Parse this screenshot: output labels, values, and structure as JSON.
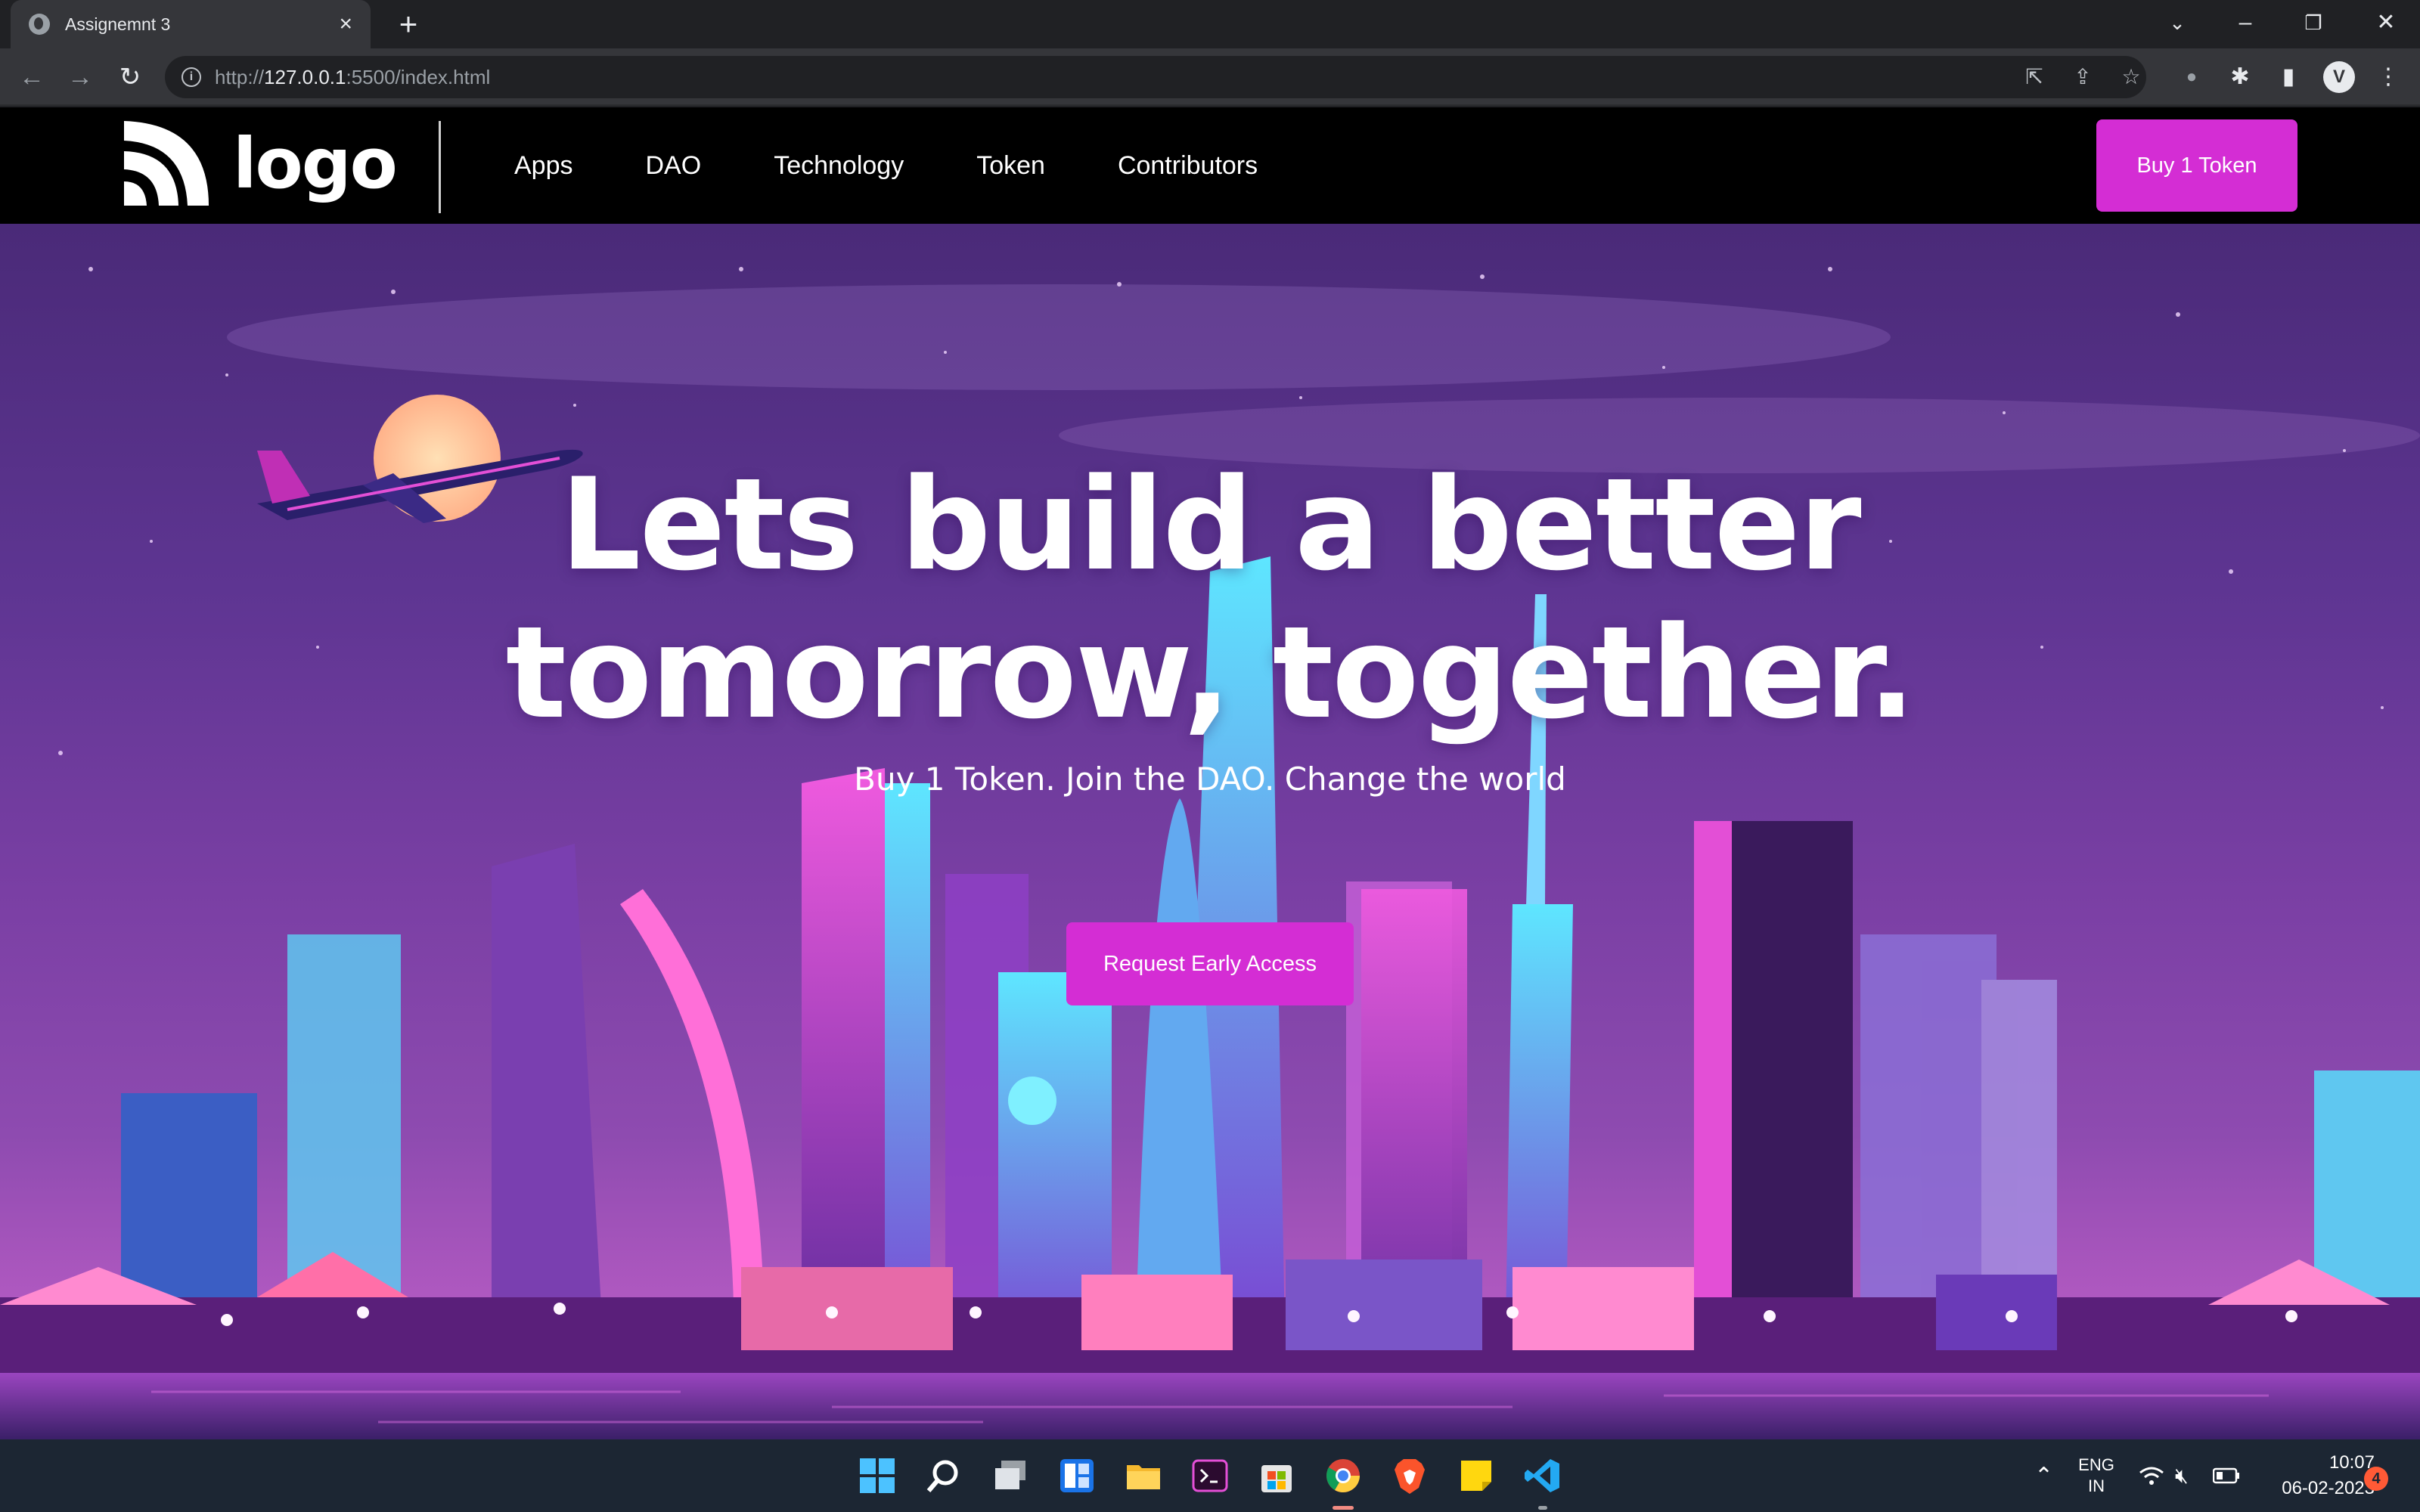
{
  "browser": {
    "tab_title": "Assignemnt 3",
    "url_prefix": "http://",
    "url_host": "127.0.0.1",
    "url_rest": ":5500/index.html",
    "profile_initial": "V"
  },
  "site": {
    "logo_text": "logo",
    "nav": [
      "Apps",
      "DAO",
      "Technology",
      "Token",
      "Contributors"
    ],
    "buy_button": "Buy 1 Token"
  },
  "hero": {
    "headline_line1": "Lets build a better",
    "headline_line2": "tomorrow, together.",
    "subline": "Buy 1 Token. Join the DAO. Change the world",
    "cta": "Request Early Access"
  },
  "taskbar": {
    "lang_top": "ENG",
    "lang_bottom": "IN",
    "time": "10:07",
    "date": "06-02-2023",
    "notifications": "4"
  },
  "colors": {
    "accent": "#d42dd4",
    "navbar": "#000000",
    "taskbar": "#1c2633"
  }
}
